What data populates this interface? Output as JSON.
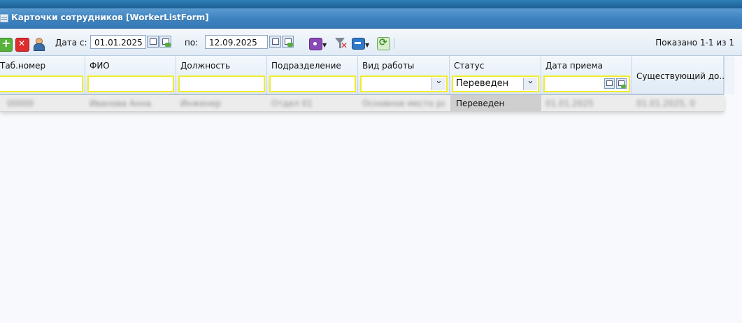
{
  "window": {
    "title": "Карточки сотрудников [WorkerListForm]"
  },
  "toolbar": {
    "date_from_label": "Дата с:",
    "date_from": "01.01.2025",
    "date_to_label": "по:",
    "date_to": "12.09.2025",
    "shown_text": "Показано 1-1 из 1"
  },
  "grid": {
    "columns": [
      {
        "label": "Таб.номер"
      },
      {
        "label": "ФИО"
      },
      {
        "label": "Должность"
      },
      {
        "label": "Подразделение"
      },
      {
        "label": "Вид работы"
      },
      {
        "label": "Статус"
      },
      {
        "label": "Дата приема"
      },
      {
        "label": "Существующий до..."
      }
    ],
    "filters": {
      "status": "Переведен"
    },
    "rows": [
      {
        "tab_number": "00000",
        "fio": "Иванова Анна",
        "position": "Инженер",
        "department": "Отдел 01",
        "work_type": "Основное место работы",
        "status": "Переведен",
        "hire_date": "01.01.2025",
        "existing": "01.01.2025, 0"
      }
    ]
  }
}
